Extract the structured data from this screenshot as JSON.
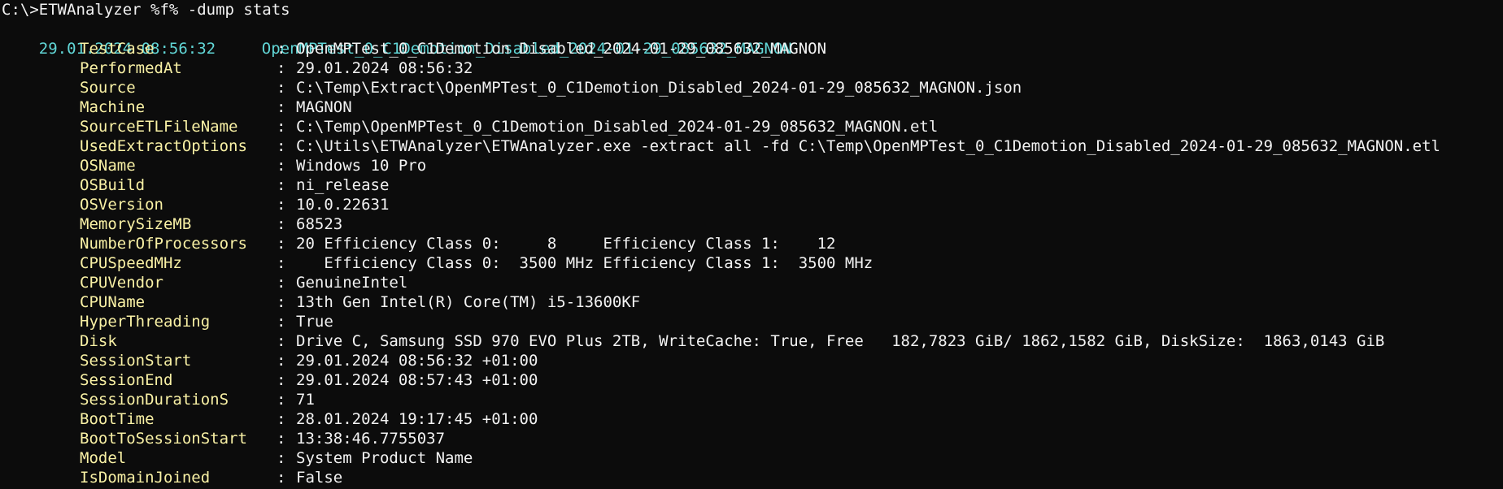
{
  "terminal": {
    "prompt": "C:\\>ETWAnalyzer %f% -dump stats",
    "header": {
      "date": "29.01.2024 08:56:32",
      "testcase": "OpenMPTest_0_C1Demotion_Disabled_2024-01-29_085632_MAGNON"
    },
    "separator": ":",
    "rows": [
      {
        "key": "TestCase",
        "value": "OpenMPTest_0_C1Demotion_Disabled_2024-01-29_085632_MAGNON"
      },
      {
        "key": "PerformedAt",
        "value": "29.01.2024 08:56:32"
      },
      {
        "key": "Source",
        "value": "C:\\Temp\\Extract\\OpenMPTest_0_C1Demotion_Disabled_2024-01-29_085632_MAGNON.json"
      },
      {
        "key": "Machine",
        "value": "MAGNON"
      },
      {
        "key": "SourceETLFileName",
        "value": "C:\\Temp\\OpenMPTest_0_C1Demotion_Disabled_2024-01-29_085632_MAGNON.etl"
      },
      {
        "key": "UsedExtractOptions",
        "value": "C:\\Utils\\ETWAnalyzer\\ETWAnalyzer.exe -extract all -fd C:\\Temp\\OpenMPTest_0_C1Demotion_Disabled_2024-01-29_085632_MAGNON.etl"
      },
      {
        "key": "OSName",
        "value": "Windows 10 Pro"
      },
      {
        "key": "OSBuild",
        "value": "ni_release"
      },
      {
        "key": "OSVersion",
        "value": "10.0.22631"
      },
      {
        "key": "MemorySizeMB",
        "value": "68523"
      },
      {
        "key": "NumberOfProcessors",
        "value": "20 Efficiency Class 0:     8     Efficiency Class 1:    12"
      },
      {
        "key": "CPUSpeedMHz",
        "value": "   Efficiency Class 0:  3500 MHz Efficiency Class 1:  3500 MHz"
      },
      {
        "key": "CPUVendor",
        "value": "GenuineIntel"
      },
      {
        "key": "CPUName",
        "value": "13th Gen Intel(R) Core(TM) i5-13600KF"
      },
      {
        "key": "HyperThreading",
        "value": "True"
      },
      {
        "key": "Disk",
        "value": "Drive C, Samsung SSD 970 EVO Plus 2TB, WriteCache: True, Free   182,7823 GiB/ 1862,1582 GiB, DiskSize:  1863,0143 GiB"
      },
      {
        "key": "SessionStart",
        "value": "29.01.2024 08:56:32 +01:00"
      },
      {
        "key": "SessionEnd",
        "value": "29.01.2024 08:57:43 +01:00"
      },
      {
        "key": "SessionDurationS",
        "value": "71"
      },
      {
        "key": "BootTime",
        "value": "28.01.2024 19:17:45 +01:00"
      },
      {
        "key": "BootToSessionStart",
        "value": "13:38:46.7755037"
      },
      {
        "key": "Model",
        "value": "System Product Name"
      },
      {
        "key": "IsDomainJoined",
        "value": "False"
      }
    ]
  },
  "colors": {
    "background": "#0c0c0c",
    "foreground": "#f2f2f2",
    "header": "#61d6d6",
    "key": "#f9f1a5"
  }
}
